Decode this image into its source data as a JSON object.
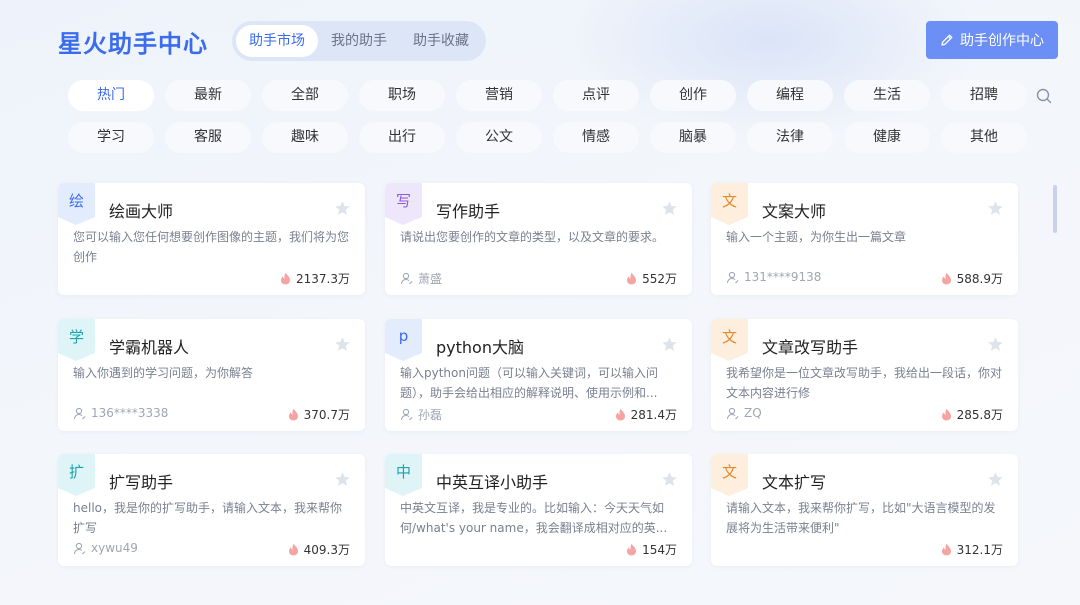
{
  "app_title": "星火助手中心",
  "tabs": [
    {
      "label": "助手市场",
      "active": true
    },
    {
      "label": "我的助手",
      "active": false
    },
    {
      "label": "助手收藏",
      "active": false
    }
  ],
  "create_button": {
    "label": "助手创作中心",
    "icon": "pencil-icon"
  },
  "categories": [
    "热门",
    "最新",
    "全部",
    "职场",
    "营销",
    "点评",
    "创作",
    "编程",
    "生活",
    "招聘",
    "学习",
    "客服",
    "趣味",
    "出行",
    "公文",
    "情感",
    "脑暴",
    "法律",
    "健康",
    "其他"
  ],
  "active_category": "热门",
  "search_icon": "search-icon",
  "colors": {
    "accent": "#3b6cf0",
    "button": "#6b8ff5",
    "flame": "#f58f8f"
  },
  "cards": [
    {
      "badge": "绘",
      "badge_bg": "#e3ecfc",
      "badge_fg": "#3b6cf0",
      "title": "绘画大师",
      "desc": "您可以输入您任何想要创作图像的主题，我们将为您创作",
      "author": "",
      "hot": "2137.3万"
    },
    {
      "badge": "写",
      "badge_bg": "#eee6fb",
      "badge_fg": "#8a5cd8",
      "title": "写作助手",
      "desc": "请说出您要创作的文章的类型，以及文章的要求。",
      "author": "萧盛",
      "hot": "552万"
    },
    {
      "badge": "文",
      "badge_bg": "#fdeedd",
      "badge_fg": "#e58a2a",
      "title": "文案大师",
      "desc": "输入一个主题，为你生出一篇文章",
      "author": "131****9138",
      "hot": "588.9万"
    },
    {
      "badge": "学",
      "badge_bg": "#dff4f6",
      "badge_fg": "#1aa3b0",
      "title": "学霸机器人",
      "desc": "输入你遇到的学习问题，为你解答",
      "author": "136****3338",
      "hot": "370.7万"
    },
    {
      "badge": "p",
      "badge_bg": "#e3ecfc",
      "badge_fg": "#3b6cf0",
      "title": "python大脑",
      "desc": "输入python问题（可以输入关键词，可以输入问题），助手会给出相应的解释说明、使用示例和...",
      "author": "孙磊",
      "hot": "281.4万"
    },
    {
      "badge": "文",
      "badge_bg": "#fdeedd",
      "badge_fg": "#e58a2a",
      "title": "文章改写助手",
      "desc": "我希望你是一位文章改写助手，我给出一段话，你对文本内容进行修",
      "author": "ZQ",
      "hot": "285.8万"
    },
    {
      "badge": "扩",
      "badge_bg": "#dff4f6",
      "badge_fg": "#1aa3b0",
      "title": "扩写助手",
      "desc": "hello，我是你的扩写助手，请输入文本，我来帮你扩写",
      "author": "xywu49",
      "hot": "409.3万"
    },
    {
      "badge": "中",
      "badge_bg": "#dff4f6",
      "badge_fg": "#1aa3b0",
      "title": "中英互译小助手",
      "desc": "中英文互译，我是专业的。比如输入：今天天气如何/what's your name，我会翻译成相对应的英...",
      "author": "",
      "hot": "154万"
    },
    {
      "badge": "文",
      "badge_bg": "#fdeedd",
      "badge_fg": "#e58a2a",
      "title": "文本扩写",
      "desc": "请输入文本，我来帮你扩写，比如\"大语言模型的发展将为生活带来便利\"",
      "author": "",
      "hot": "312.1万"
    }
  ]
}
